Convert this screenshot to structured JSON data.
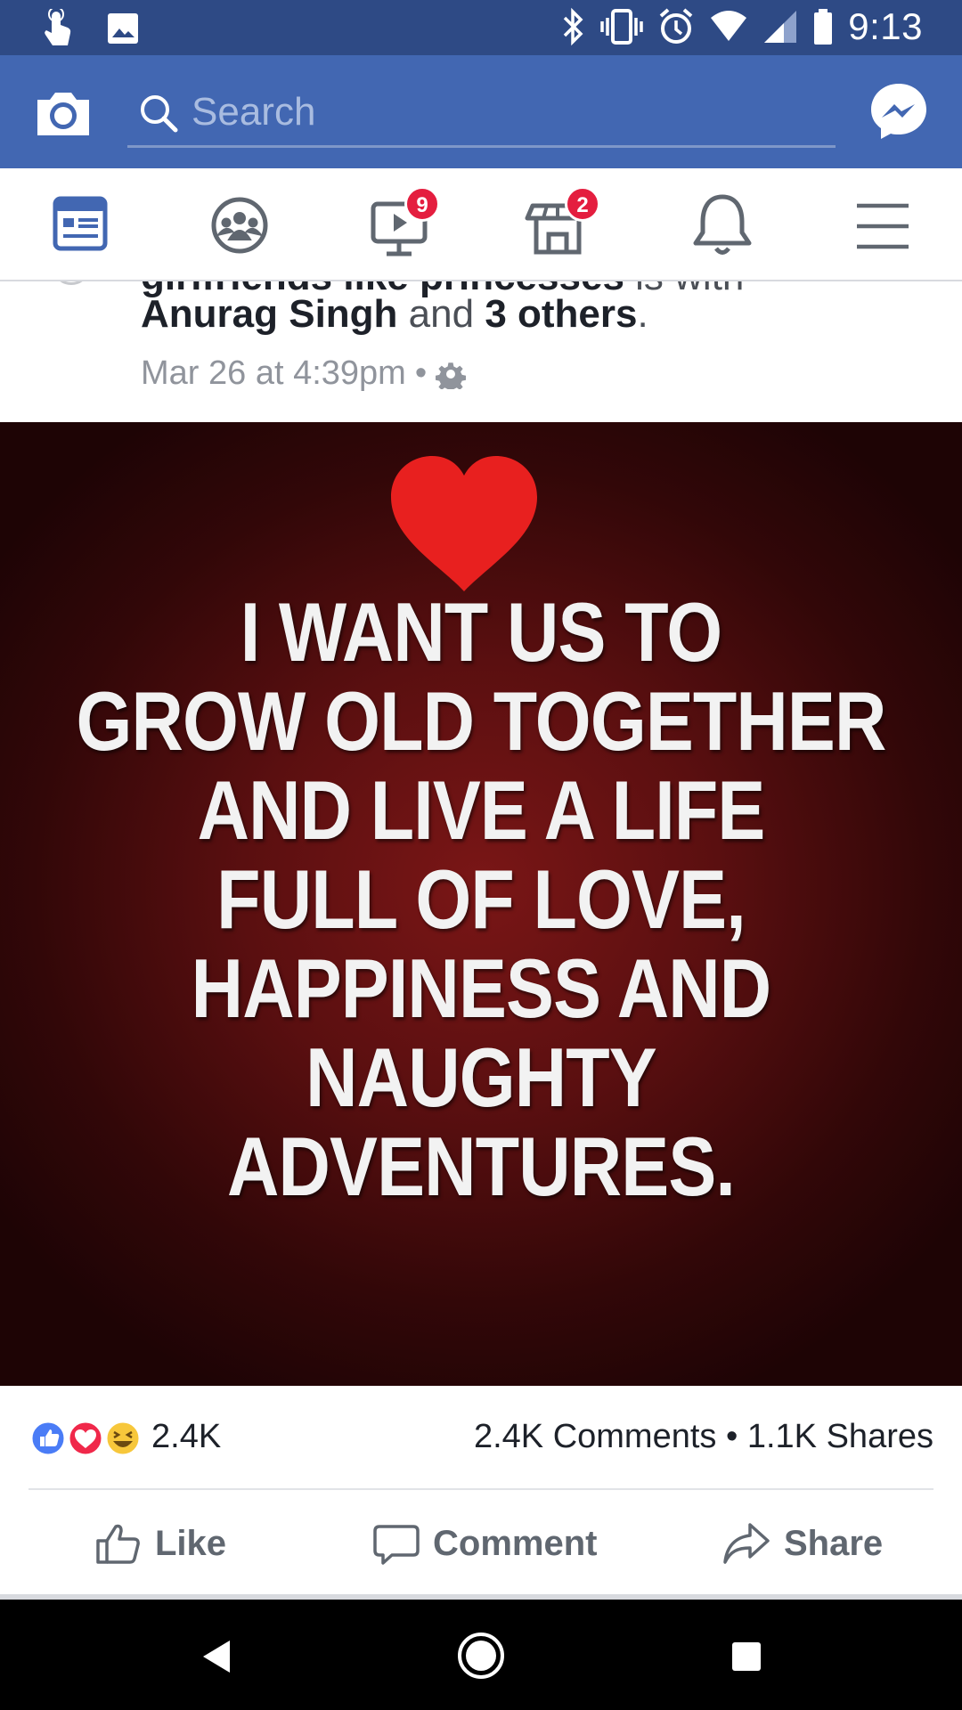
{
  "status_bar": {
    "time": "9:13",
    "left_icons": [
      "touch-icon",
      "image-icon"
    ],
    "right_icons": [
      "bluetooth-icon",
      "vibrate-icon",
      "alarm-icon",
      "wifi-icon",
      "signal-icon",
      "battery-icon"
    ]
  },
  "header": {
    "search_placeholder": "Search",
    "camera_icon": "camera-icon",
    "messenger_icon": "messenger-icon",
    "background": "#4267b2"
  },
  "nav": {
    "tabs": [
      {
        "name": "news-feed",
        "icon": "news-feed-icon",
        "active": true
      },
      {
        "name": "groups",
        "icon": "groups-icon"
      },
      {
        "name": "watch",
        "icon": "watch-icon",
        "badge": "9"
      },
      {
        "name": "marketplace",
        "icon": "marketplace-icon",
        "badge": "2"
      },
      {
        "name": "notifications",
        "icon": "bell-icon"
      },
      {
        "name": "menu",
        "icon": "hamburger-icon"
      }
    ],
    "active_color": "#4267b2"
  },
  "post": {
    "clipped_title": "girlfriends like princesses",
    "clipped_suffix": "is with",
    "tagged": {
      "name": "Anurag Singh",
      "conjunction": "and",
      "others": "3 others",
      "period": "."
    },
    "timestamp": "Mar 26 at 4:39pm",
    "separator": "•",
    "privacy_icon": "gear-icon",
    "image": {
      "heart_color": "#e8201f",
      "quote_lines": [
        "I WANT US TO",
        "GROW OLD TOGETHER",
        "AND LIVE A LIFE",
        "FULL OF LOVE,",
        "HAPPINESS AND",
        "NAUGHTY",
        "ADVENTURES."
      ]
    },
    "reactions": {
      "icons": [
        "like-reaction-icon",
        "love-reaction-icon",
        "haha-reaction-icon"
      ],
      "count": "2.4K"
    },
    "engagement": {
      "comments": "2.4K Comments",
      "separator": "•",
      "shares": "1.1K Shares"
    },
    "actions": {
      "like": "Like",
      "comment": "Comment",
      "share": "Share"
    }
  },
  "android_nav": [
    "back-icon",
    "home-icon",
    "recents-icon"
  ]
}
